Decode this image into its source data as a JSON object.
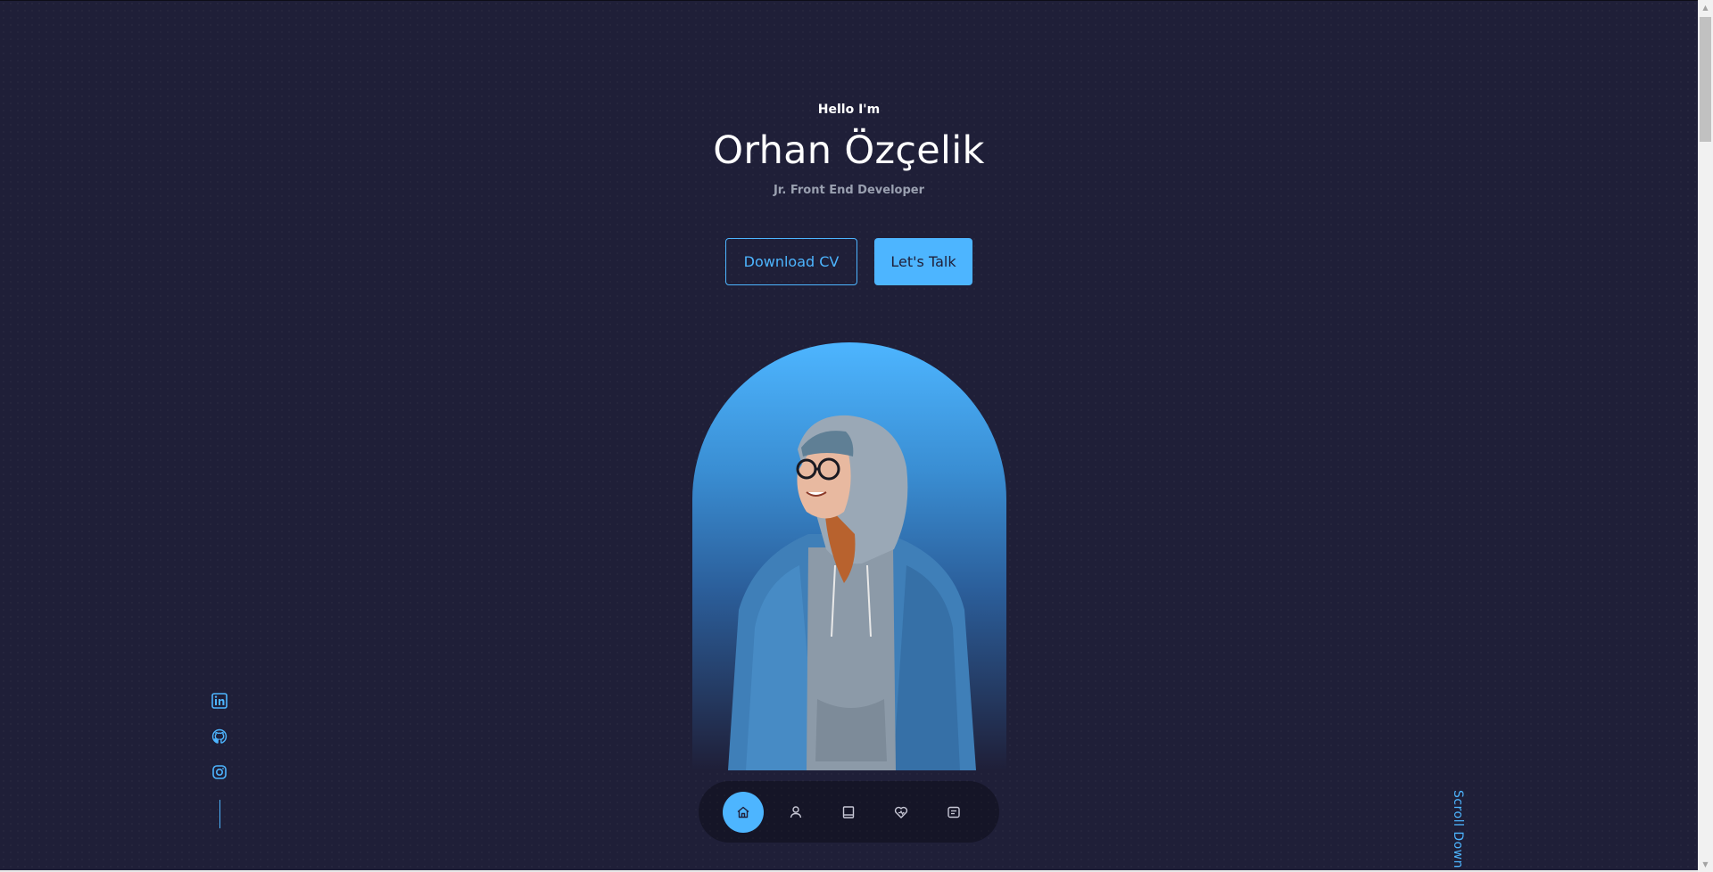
{
  "hero": {
    "greeting": "Hello I'm",
    "name": "Orhan Özçelik",
    "role": "Jr. Front End Developer",
    "download_cv_label": "Download CV",
    "lets_talk_label": "Let's Talk"
  },
  "portrait": {
    "icon": "person-photo"
  },
  "socials": [
    {
      "icon": "linkedin-icon"
    },
    {
      "icon": "github-icon"
    },
    {
      "icon": "instagram-icon"
    }
  ],
  "scroll_down_label": "Scroll Down",
  "nav": {
    "items": [
      {
        "icon": "home-icon",
        "active": true
      },
      {
        "icon": "user-icon",
        "active": false
      },
      {
        "icon": "book-icon",
        "active": false
      },
      {
        "icon": "services-icon",
        "active": false
      },
      {
        "icon": "message-icon",
        "active": false
      }
    ]
  },
  "colors": {
    "background": "#1f1f38",
    "accent": "#4db5ff",
    "text": "#ffffff",
    "muted": "#9aa0b0"
  }
}
